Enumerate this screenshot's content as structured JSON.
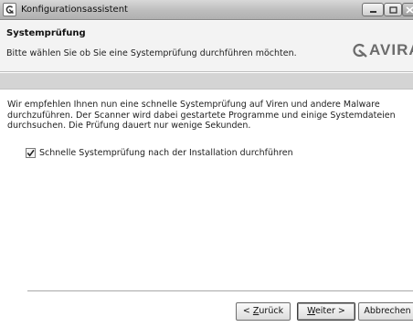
{
  "window": {
    "title": "Konfigurationsassistent"
  },
  "header": {
    "title": "Systemprüfung",
    "subtitle": "Bitte wählen Sie ob Sie eine Systemprüfung durchführen möchten.",
    "logo_text": "AVIRA"
  },
  "content": {
    "description_lines": [
      "Wir empfehlen Ihnen nun eine schnelle Systemprüfung auf Viren und andere Malware",
      "durchzuführen. Der Scanner wird dabei gestartete Programme und einige Systemdateien",
      "durchsuchen. Die Prüfung dauert nur wenige Sekunden."
    ],
    "checkbox": {
      "label": "Schnelle Systemprüfung nach der Installation durchführen",
      "checked": true
    }
  },
  "buttons": {
    "back": {
      "prefix": "< ",
      "accel": "Z",
      "rest": "urück"
    },
    "next": {
      "accel": "W",
      "rest": "eiter >"
    },
    "cancel": "Abbrechen"
  }
}
